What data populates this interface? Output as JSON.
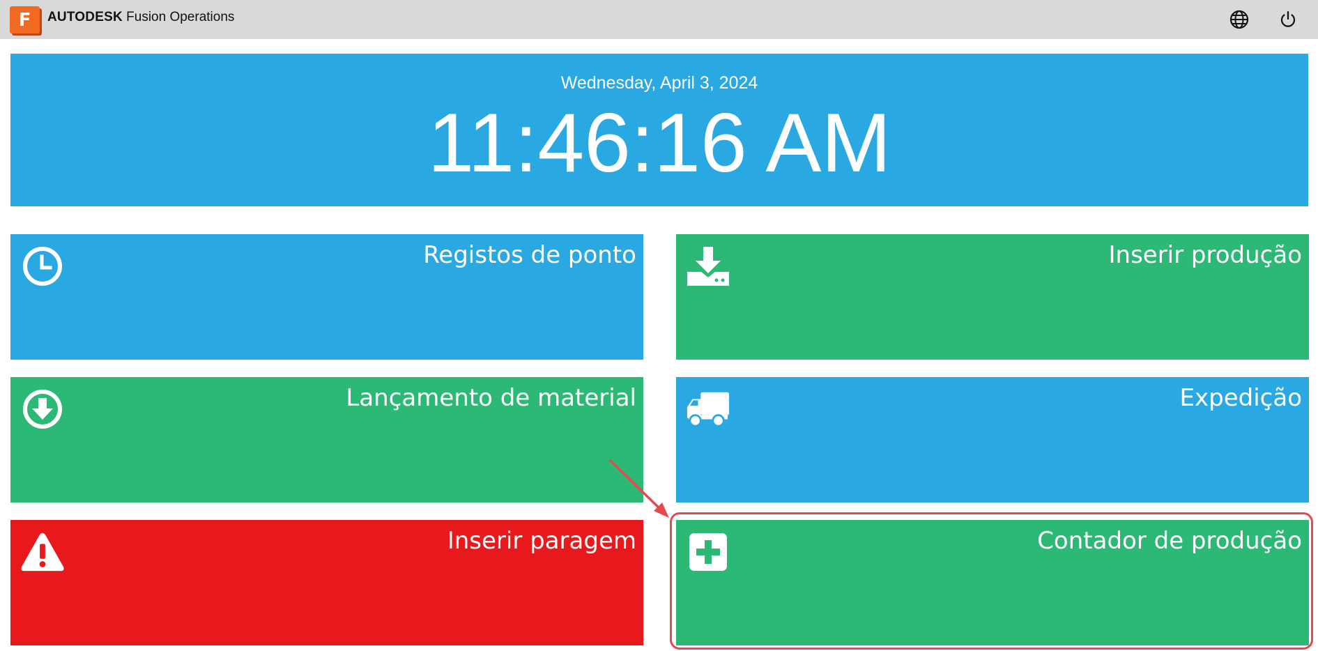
{
  "header": {
    "logo_letter": "F",
    "brand_strong": "AUTODESK",
    "brand_product": "Fusion Operations",
    "globe_icon": "globe-icon",
    "power_icon": "power-icon"
  },
  "clock": {
    "date": "Wednesday, April 3, 2024",
    "time": "11:46:16 AM"
  },
  "tiles": [
    {
      "label": "Registos de ponto",
      "icon": "clock-icon",
      "color": "#29a8e2"
    },
    {
      "label": "Inserir produção",
      "icon": "download-tray-icon",
      "color": "#2bb975"
    },
    {
      "label": "Lançamento de material",
      "icon": "arrow-down-circle-icon",
      "color": "#2bb975"
    },
    {
      "label": "Expedição",
      "icon": "truck-icon",
      "color": "#29a8e2"
    },
    {
      "label": "Inserir paragem",
      "icon": "warning-icon",
      "color": "#e8191c"
    },
    {
      "label": "Contador de produção",
      "icon": "plus-square-icon",
      "color": "#2bb975"
    }
  ],
  "annotation": {
    "highlight_color": "#e5484d",
    "target": "Contador de produção"
  }
}
